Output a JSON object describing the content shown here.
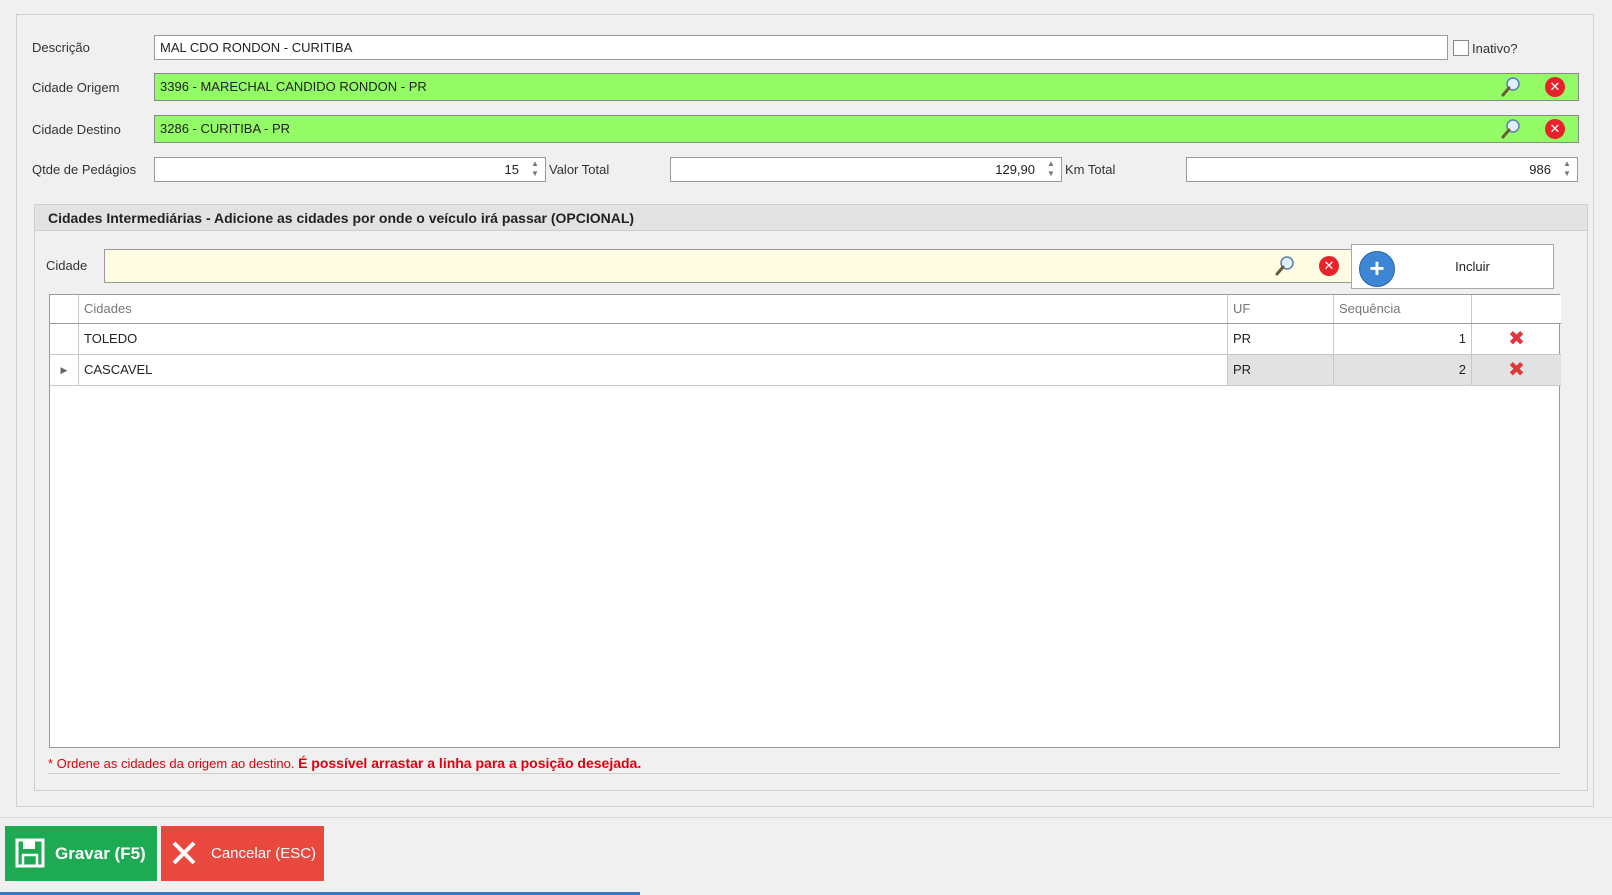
{
  "form": {
    "descricao": {
      "label": "Descrição",
      "value": "MAL CDO RONDON - CURITIBA"
    },
    "inativo": {
      "label": "Inativo?",
      "checked": false
    },
    "cidade_origem": {
      "label": "Cidade Origem",
      "value": "3396 - MARECHAL CANDIDO RONDON - PR"
    },
    "cidade_destino": {
      "label": "Cidade Destino",
      "value": "3286 - CURITIBA - PR"
    },
    "qtde_pedagios": {
      "label": "Qtde de Pedágios",
      "value": "15"
    },
    "valor_total": {
      "label": "Valor Total",
      "value": "129,90"
    },
    "km_total": {
      "label": "Km Total",
      "value": "986"
    }
  },
  "intermediarias": {
    "title": "Cidades Intermediárias - Adicione as cidades por onde o veículo irá passar (OPCIONAL)",
    "cidade_label": "Cidade",
    "cidade_value": "",
    "incluir_label": "Incluir",
    "columns": {
      "cidades": "Cidades",
      "uf": "UF",
      "sequencia": "Sequência"
    },
    "rows": [
      {
        "cidade": "TOLEDO",
        "uf": "PR",
        "sequencia": "1"
      },
      {
        "cidade": "CASCAVEL",
        "uf": "PR",
        "sequencia": "2"
      }
    ],
    "note_prefix": "* Ordene as cidades da origem ao destino.",
    "note_bold": "É possível arrastar a linha para a posição desejada."
  },
  "buttons": {
    "gravar": "Gravar (F5)",
    "cancelar": "Cancelar (ESC)"
  },
  "colors": {
    "lookup_filled": "#93fb65",
    "lookup_empty": "#fefde3",
    "save": "#1eaa52",
    "cancel": "#e8483e",
    "note": "#e0000f"
  },
  "icons": [
    "search-icon",
    "clear-icon",
    "plus-icon",
    "delete-icon",
    "save-icon",
    "cancel-icon",
    "row-pointer-icon"
  ]
}
